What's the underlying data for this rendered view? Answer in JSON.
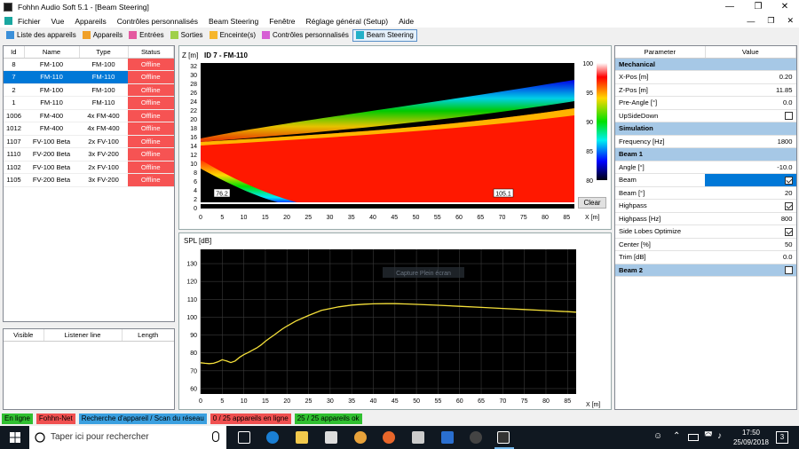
{
  "window": {
    "title": "Fohhn Audio Soft 5.1 - [Beam Steering]"
  },
  "menu": [
    "Fichier",
    "Vue",
    "Appareils",
    "Contrôles personnalisés",
    "Beam Steering",
    "Fenêtre",
    "Réglage général (Setup)",
    "Aide"
  ],
  "tabs": [
    {
      "label": "Liste des appareils",
      "color": "#3b8fd9"
    },
    {
      "label": "Appareils",
      "color": "#f0a028"
    },
    {
      "label": "Entrées",
      "color": "#e45aa0"
    },
    {
      "label": "Sorties",
      "color": "#9fd04a"
    },
    {
      "label": "Enceinte(s)",
      "color": "#f6b62c"
    },
    {
      "label": "Contrôles personnalisés",
      "color": "#d65ed4"
    },
    {
      "label": "Beam Steering",
      "color": "#22b0c8"
    }
  ],
  "devices": {
    "columns": [
      "Id",
      "Name",
      "Type",
      "Status"
    ],
    "rows": [
      [
        "8",
        "FM-100",
        "FM-100",
        "Offline"
      ],
      [
        "7",
        "FM-110",
        "FM-110",
        "Offline"
      ],
      [
        "2",
        "FM-100",
        "FM-100",
        "Offline"
      ],
      [
        "1",
        "FM-110",
        "FM-110",
        "Offline"
      ],
      [
        "1006",
        "FM-400",
        "4x FM-400",
        "Offline"
      ],
      [
        "1012",
        "FM-400",
        "4x FM-400",
        "Offline"
      ],
      [
        "1107",
        "FV-100 Beta",
        "2x FV-100",
        "Offline"
      ],
      [
        "1110",
        "FV-200 Beta",
        "3x FV-200",
        "Offline"
      ],
      [
        "1102",
        "FV-100 Beta",
        "2x FV-100",
        "Offline"
      ],
      [
        "1105",
        "FV-200 Beta",
        "3x FV-200",
        "Offline"
      ]
    ],
    "selected_index": 1
  },
  "listener": {
    "columns": [
      "Visible",
      "Listener line",
      "Length"
    ]
  },
  "heatmap": {
    "title": "ID 7 - FM-110",
    "ylabel": "Z [m]",
    "xlabel": "X [m]",
    "yticks": [
      "0",
      "2",
      "4",
      "6",
      "8",
      "10",
      "12",
      "14",
      "16",
      "18",
      "20",
      "22",
      "24",
      "26",
      "28",
      "30",
      "32"
    ],
    "xticks": [
      "0",
      "5",
      "10",
      "15",
      "20",
      "25",
      "30",
      "35",
      "40",
      "45",
      "50",
      "55",
      "60",
      "65",
      "70",
      "75",
      "80",
      "85"
    ],
    "markers": [
      "76.2",
      "105.1"
    ],
    "colorbar_ticks": [
      "100",
      "95",
      "90",
      "85",
      "80"
    ],
    "clear_label": "Clear"
  },
  "chart_data": {
    "type": "line",
    "title": "",
    "xlabel": "X [m]",
    "ylabel": "SPL [dB]",
    "xlim": [
      0,
      87
    ],
    "ylim": [
      57,
      138
    ],
    "xticks": [
      0,
      5,
      10,
      15,
      20,
      25,
      30,
      35,
      40,
      45,
      50,
      55,
      60,
      65,
      70,
      75,
      80,
      85
    ],
    "yticks": [
      60,
      70,
      80,
      90,
      100,
      110,
      120,
      130
    ],
    "grid": true,
    "series": [
      {
        "color": "#f5e03a",
        "x": [
          0,
          1,
          2,
          3,
          4,
          5,
          6,
          7,
          8,
          9,
          10,
          11,
          12,
          13,
          14,
          15,
          16,
          17,
          18,
          19,
          20,
          22,
          25,
          28,
          30,
          32,
          35,
          38,
          40,
          43,
          45,
          48,
          50,
          55,
          60,
          65,
          70,
          75,
          80,
          85,
          87
        ],
        "y": [
          74.5,
          74.2,
          74.0,
          74.2,
          75.0,
          76.2,
          75.5,
          74.6,
          75.5,
          77.5,
          79.0,
          80.2,
          81.5,
          82.8,
          84.5,
          86.5,
          88.3,
          90.0,
          91.8,
          93.5,
          95.0,
          97.8,
          101.0,
          103.8,
          104.8,
          105.8,
          106.8,
          107.3,
          107.5,
          107.6,
          107.6,
          107.4,
          107.2,
          106.7,
          106.1,
          105.5,
          104.9,
          104.3,
          103.7,
          103.1,
          102.8
        ]
      }
    ]
  },
  "watermark": "Capture Plein écran",
  "params": {
    "columns": [
      "Parameter",
      "Value"
    ],
    "rows": [
      {
        "type": "header",
        "label": "Mechanical",
        "check": null
      },
      {
        "label": "X-Pos [m]",
        "value": "0.20"
      },
      {
        "label": "Z-Pos [m]",
        "value": "11.85"
      },
      {
        "label": "Pre-Angle [°]",
        "value": "0.0"
      },
      {
        "label": "UpSideDown",
        "check": false
      },
      {
        "type": "header",
        "label": "Simulation",
        "check": null
      },
      {
        "label": "Frequency [Hz]",
        "value": "1800"
      },
      {
        "type": "header",
        "label": "Beam 1",
        "check": null
      },
      {
        "label": "Angle [°]",
        "value": "-10.0"
      },
      {
        "label": "Beam",
        "check": true,
        "selected": true
      },
      {
        "label": "Beam [°]",
        "value": "20"
      },
      {
        "label": "Highpass",
        "check": true
      },
      {
        "label": "Highpass [Hz]",
        "value": "800"
      },
      {
        "label": "Side Lobes Optimize",
        "check": true
      },
      {
        "label": "Center [%]",
        "value": "50"
      },
      {
        "label": "Trim [dB]",
        "value": "0.0"
      },
      {
        "type": "header",
        "label": "Beam 2",
        "check": false
      }
    ]
  },
  "status": [
    {
      "label": "En ligne",
      "color": "#30c030"
    },
    {
      "label": "Fohhn-Net",
      "color": "#f05050"
    },
    {
      "label": "Recherche d'appareil / Scan du réseau",
      "color": "#3ba0e0"
    },
    {
      "label": "0 / 25 appareils en ligne",
      "color": "#f05050"
    },
    {
      "label": "25 / 25 appareils ok",
      "color": "#30c030"
    }
  ],
  "taskbar": {
    "search_placeholder": "Taper ici pour rechercher",
    "time": "17:50",
    "date": "25/09/2018",
    "notifications": "3"
  }
}
